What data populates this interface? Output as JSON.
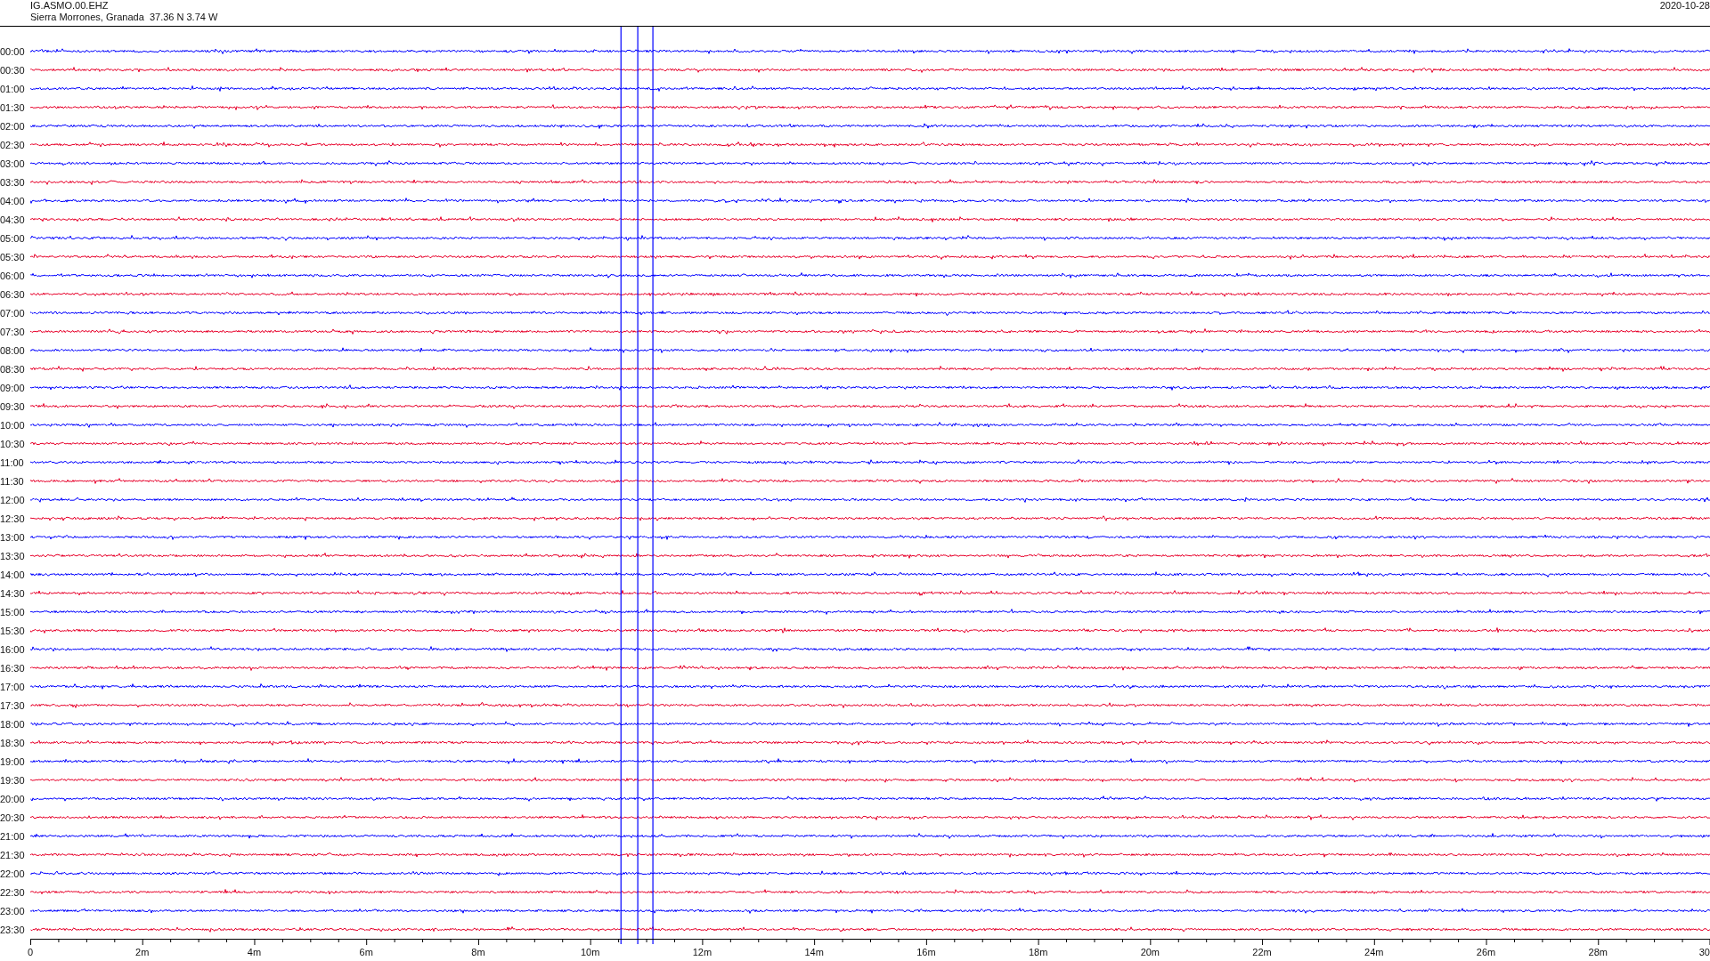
{
  "header": {
    "station": "IG.ASMO.00.EHZ",
    "location": "Sierra Morrones, Granada  37.36 N 3.74 W",
    "date": "2020-10-28"
  },
  "rows": [
    {
      "time": "00:00",
      "color": "#0000ff"
    },
    {
      "time": "00:30",
      "color": "#e8002a"
    },
    {
      "time": "01:00",
      "color": "#0000ff"
    },
    {
      "time": "01:30",
      "color": "#e8002a"
    },
    {
      "time": "02:00",
      "color": "#0000ff"
    },
    {
      "time": "02:30",
      "color": "#e8002a"
    },
    {
      "time": "03:00",
      "color": "#0000ff"
    },
    {
      "time": "03:30",
      "color": "#e8002a"
    },
    {
      "time": "04:00",
      "color": "#0000ff"
    },
    {
      "time": "04:30",
      "color": "#e8002a"
    },
    {
      "time": "05:00",
      "color": "#0000ff"
    },
    {
      "time": "05:30",
      "color": "#e8002a"
    },
    {
      "time": "06:00",
      "color": "#0000ff"
    },
    {
      "time": "06:30",
      "color": "#e8002a"
    },
    {
      "time": "07:00",
      "color": "#0000ff"
    },
    {
      "time": "07:30",
      "color": "#e8002a"
    },
    {
      "time": "08:00",
      "color": "#0000ff"
    },
    {
      "time": "08:30",
      "color": "#e8002a"
    },
    {
      "time": "09:00",
      "color": "#0000ff"
    },
    {
      "time": "09:30",
      "color": "#e8002a"
    },
    {
      "time": "10:00",
      "color": "#0000ff"
    },
    {
      "time": "10:30",
      "color": "#e8002a"
    },
    {
      "time": "11:00",
      "color": "#0000ff"
    },
    {
      "time": "11:30",
      "color": "#e8002a"
    },
    {
      "time": "12:00",
      "color": "#0000ff"
    },
    {
      "time": "12:30",
      "color": "#e8002a"
    },
    {
      "time": "13:00",
      "color": "#0000ff"
    },
    {
      "time": "13:30",
      "color": "#e8002a"
    },
    {
      "time": "14:00",
      "color": "#0000ff"
    },
    {
      "time": "14:30",
      "color": "#e8002a"
    },
    {
      "time": "15:00",
      "color": "#0000ff"
    },
    {
      "time": "15:30",
      "color": "#e8002a"
    },
    {
      "time": "16:00",
      "color": "#0000ff"
    },
    {
      "time": "16:30",
      "color": "#e8002a"
    },
    {
      "time": "17:00",
      "color": "#0000ff"
    },
    {
      "time": "17:30",
      "color": "#e8002a"
    },
    {
      "time": "18:00",
      "color": "#0000ff"
    },
    {
      "time": "18:30",
      "color": "#e8002a"
    },
    {
      "time": "19:00",
      "color": "#0000ff"
    },
    {
      "time": "19:30",
      "color": "#e8002a"
    },
    {
      "time": "20:00",
      "color": "#0000ff"
    },
    {
      "time": "20:30",
      "color": "#e8002a"
    },
    {
      "time": "21:00",
      "color": "#0000ff"
    },
    {
      "time": "21:30",
      "color": "#e8002a"
    },
    {
      "time": "22:00",
      "color": "#0000ff"
    },
    {
      "time": "22:30",
      "color": "#e8002a"
    },
    {
      "time": "23:00",
      "color": "#0000ff"
    },
    {
      "time": "23:30",
      "color": "#e8002a"
    }
  ],
  "x_axis": {
    "labels": [
      "0",
      "2m",
      "4m",
      "6m",
      "8m",
      "10m",
      "12m",
      "14m",
      "16m",
      "18m",
      "20m",
      "22m",
      "24m",
      "26m",
      "28m",
      "30"
    ]
  }
}
